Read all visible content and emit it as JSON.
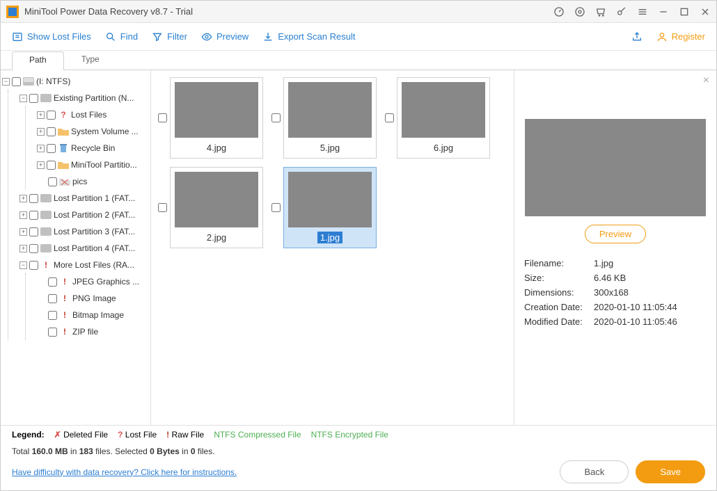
{
  "title": "MiniTool Power Data Recovery v8.7 - Trial",
  "toolbar": {
    "show_lost": "Show Lost Files",
    "find": "Find",
    "filter": "Filter",
    "preview": "Preview",
    "export": "Export Scan Result",
    "register": "Register"
  },
  "tabs": {
    "path": "Path",
    "type": "Type"
  },
  "tree": {
    "root": "(I: NTFS)",
    "existing": "Existing Partition (N...",
    "lost_files": "Lost Files",
    "sysvol": "System Volume ...",
    "recycle": "Recycle Bin",
    "minitool": "MiniTool Partitio...",
    "pics": "pics",
    "lp1": "Lost Partition 1 (FAT...",
    "lp2": "Lost Partition 2 (FAT...",
    "lp3": "Lost Partition 3 (FAT...",
    "lp4": "Lost Partition 4 (FAT...",
    "more": "More Lost Files (RA...",
    "jpeg": "JPEG Graphics ...",
    "png": "PNG Image",
    "bmp": "Bitmap Image",
    "zip": "ZIP file"
  },
  "thumbs": [
    {
      "name": "4.jpg",
      "bg": "bg4"
    },
    {
      "name": "5.jpg",
      "bg": "bg5"
    },
    {
      "name": "6.jpg",
      "bg": "bg6"
    },
    {
      "name": "2.jpg",
      "bg": "bg2"
    },
    {
      "name": "1.jpg",
      "bg": "bg1",
      "selected": true
    }
  ],
  "preview": {
    "button": "Preview",
    "filename_l": "Filename:",
    "filename_v": "1.jpg",
    "size_l": "Size:",
    "size_v": "6.46 KB",
    "dim_l": "Dimensions:",
    "dim_v": "300x168",
    "created_l": "Creation Date:",
    "created_v": "2020-01-10 11:05:44",
    "modified_l": "Modified Date:",
    "modified_v": "2020-01-10 11:05:46"
  },
  "legend": {
    "label": "Legend:",
    "deleted": "Deleted File",
    "lost": "Lost File",
    "raw": "Raw File",
    "ntfsc": "NTFS Compressed File",
    "ntfse": "NTFS Encrypted File"
  },
  "status": {
    "total_pre": "Total ",
    "total_mb": "160.0 MB",
    "total_mid": " in ",
    "total_files": "183",
    "total_post": " files.  Selected ",
    "sel_bytes": "0 Bytes",
    "sel_mid": " in ",
    "sel_files": "0",
    "sel_post": " files."
  },
  "help_link": "Have difficulty with data recovery? Click here for instructions.",
  "buttons": {
    "back": "Back",
    "save": "Save"
  }
}
